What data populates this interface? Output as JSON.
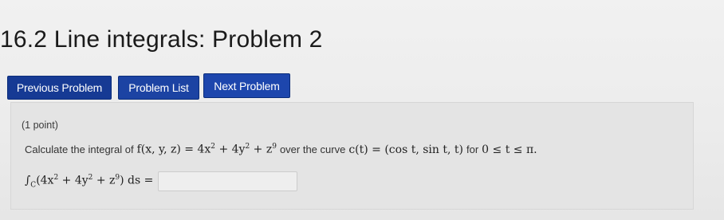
{
  "page": {
    "title": "16.2 Line integrals: Problem 2"
  },
  "nav": {
    "previous_label": "Previous Problem",
    "list_label": "Problem List",
    "next_label": "Next Problem"
  },
  "problem": {
    "points": "(1 point)",
    "prompt_prefix": "Calculate the integral of",
    "function_lhs": "f(x, y, z) = 4x",
    "function_rhs_a": " + 4y",
    "function_rhs_b": " + z",
    "exp_2": "2",
    "exp_9": "9",
    "prompt_middle": "over the curve",
    "curve": "c(t) = (cos t, sin t, t)",
    "prompt_for": "for",
    "domain": "0 ≤ t ≤ π.",
    "answer_label_a": "∫",
    "answer_label_sub": "C",
    "answer_label_b": "(4x",
    "answer_label_c": " + 4y",
    "answer_label_d": " + z",
    "answer_label_e": ") ds =",
    "answer_value": ""
  }
}
